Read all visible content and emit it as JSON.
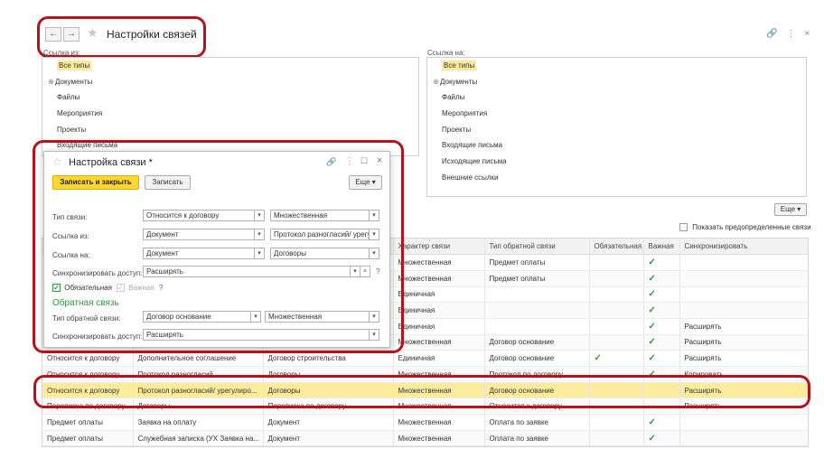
{
  "window": {
    "title": "Настройки связей"
  },
  "left_panel": {
    "label": "Ссылка из:",
    "items": [
      "Все типы",
      "Документы",
      "Файлы",
      "Мероприятия",
      "Проекты",
      "Входящие письма"
    ]
  },
  "right_panel": {
    "label": "Ссылка на:",
    "items": [
      "Все типы",
      "Документы",
      "Файлы",
      "Мероприятия",
      "Проекты",
      "Входящие письма",
      "Исходящие письма",
      "Внешние ссылки"
    ]
  },
  "toolbar": {
    "more_label": "Еще",
    "show_predefined_label": "Показать предопределенные связи"
  },
  "table": {
    "headers": [
      "Характер связи",
      "Тип обратной связи",
      "Обязательная",
      "Важная",
      "Синхронизировать"
    ],
    "rows": [
      {
        "c1": "",
        "c2": "",
        "c3": "",
        "c4": "Множественная",
        "c5": "Предмет оплаты",
        "c6": false,
        "c7": true,
        "c8": ""
      },
      {
        "c1": "",
        "c2": "",
        "c3": "",
        "c4": "Множественная",
        "c5": "Предмет оплаты",
        "c6": false,
        "c7": true,
        "c8": ""
      },
      {
        "c1": "",
        "c2": "",
        "c3": "",
        "c4": "Единичная",
        "c5": "",
        "c6": false,
        "c7": true,
        "c8": ""
      },
      {
        "c1": "",
        "c2": "",
        "c3": "",
        "c4": "Единичная",
        "c5": "",
        "c6": false,
        "c7": true,
        "c8": ""
      },
      {
        "c1": "",
        "c2": "",
        "c3": "",
        "c4": "Единичная",
        "c5": "",
        "c6": false,
        "c7": true,
        "c8": "Расширять"
      },
      {
        "c1": "",
        "c2": "",
        "c3": "",
        "c4": "Множественная",
        "c5": "Договор основание",
        "c6": false,
        "c7": true,
        "c8": "Расширять"
      },
      {
        "c1": "Относится к договору",
        "c2": "Дополнительное соглашение",
        "c3": "Договор строительства",
        "c4": "Единичная",
        "c5": "Договор основание",
        "c6": true,
        "c7": true,
        "c8": "Расширять"
      },
      {
        "c1": "Относится к договору",
        "c2": "Протокол разногласий",
        "c3": "Договоры",
        "c4": "Множественная",
        "c5": "Протокол по договору",
        "c6": false,
        "c7": true,
        "c8": "Копировать"
      },
      {
        "c1": "Относится к договору",
        "c2": "Протокол разногласий/ урегулиро...",
        "c3": "Договоры",
        "c4": "Множественная",
        "c5": "Договор основание",
        "c6": false,
        "c7": false,
        "c8": "Расширять"
      },
      {
        "c1": "Переписка по договору",
        "c2": "Договоры",
        "c3": "Переписка по договору",
        "c4": "Множественная",
        "c5": "Относится к договору",
        "c6": false,
        "c7": false,
        "c8": "Расширять"
      },
      {
        "c1": "Предмет оплаты",
        "c2": "Заявка на оплату",
        "c3": "Документ",
        "c4": "Множественная",
        "c5": "Оплата по заявке",
        "c6": false,
        "c7": true,
        "c8": ""
      },
      {
        "c1": "Предмет оплаты",
        "c2": "Служебная записка (УХ Заявка на...",
        "c3": "Документ",
        "c4": "Множественная",
        "c5": "Оплата по заявке",
        "c6": false,
        "c7": true,
        "c8": ""
      }
    ]
  },
  "dialog": {
    "title": "Настройка связи *",
    "save_close": "Записать и закрыть",
    "save": "Записать",
    "more": "Еще",
    "link_type_label": "Тип связи:",
    "link_type_value": "Относится к договору",
    "link_type_kind": "Множественная",
    "from_label": "Ссылка из:",
    "from_value": "Документ",
    "from_kind": "Протокол разногласий/ урегулиро",
    "to_label": "Ссылка на:",
    "to_value": "Документ",
    "to_kind": "Договоры",
    "sync_label": "Синхронизировать доступ:",
    "sync_value": "Расширять",
    "required_label": "Обязательная",
    "important_label": "Важная",
    "help": "?",
    "reverse_section": "Обратная связь",
    "reverse_type_label": "Тип обратной связи:",
    "reverse_type_value": "Договор основание",
    "reverse_type_kind": "Множественная",
    "reverse_sync_label": "Синхронизировать доступ:",
    "reverse_sync_value": "Расширять"
  },
  "colors": {
    "accent_green": "#2e9a3a",
    "highlight": "#fcec9c",
    "red_frame": "#b5121b",
    "primary_button": "#ffd633"
  }
}
